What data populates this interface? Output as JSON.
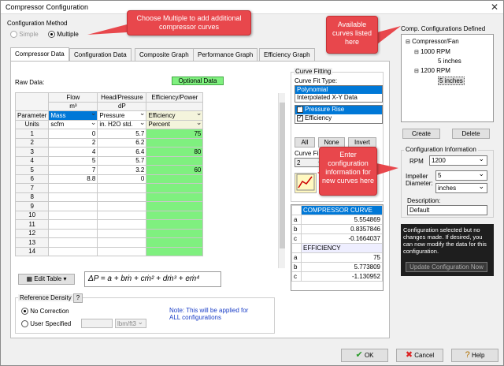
{
  "window": {
    "title": "Compressor Configuration",
    "close_glyph": "✕"
  },
  "method": {
    "label": "Configuration Method",
    "simple": "Simple",
    "multiple": "Multiple"
  },
  "tabs": [
    "Compressor Data",
    "Configuration Data",
    "Composite Graph",
    "Performance Graph",
    "Efficiency Graph"
  ],
  "raw_data_label": "Raw Data:",
  "optional_data": "Optional Data",
  "grid": {
    "col_flow": "Flow",
    "col_flow_unit": "m³",
    "col_head": "Head/Pressure",
    "col_head_unit": "dP",
    "col_eff": "Efficiency/Power",
    "param_label": "Parameter",
    "units_label": "Units",
    "param": {
      "flow": "Mass",
      "head": "Pressure",
      "eff": "Efficiency"
    },
    "units": {
      "flow": "scfm",
      "head": "in. H2O std.",
      "eff": "Percent"
    },
    "rows": [
      {
        "n": "1",
        "flow": "0",
        "head": "5.7",
        "eff": "75"
      },
      {
        "n": "2",
        "flow": "2",
        "head": "6.2",
        "eff": ""
      },
      {
        "n": "3",
        "flow": "4",
        "head": "6.4",
        "eff": "80"
      },
      {
        "n": "4",
        "flow": "5",
        "head": "5.7",
        "eff": ""
      },
      {
        "n": "5",
        "flow": "7",
        "head": "3.2",
        "eff": "60"
      },
      {
        "n": "6",
        "flow": "8.8",
        "head": "0",
        "eff": ""
      },
      {
        "n": "7",
        "flow": "",
        "head": "",
        "eff": ""
      },
      {
        "n": "8",
        "flow": "",
        "head": "",
        "eff": ""
      },
      {
        "n": "9",
        "flow": "",
        "head": "",
        "eff": ""
      },
      {
        "n": "10",
        "flow": "",
        "head": "",
        "eff": ""
      },
      {
        "n": "11",
        "flow": "",
        "head": "",
        "eff": ""
      },
      {
        "n": "12",
        "flow": "",
        "head": "",
        "eff": ""
      },
      {
        "n": "13",
        "flow": "",
        "head": "",
        "eff": ""
      },
      {
        "n": "14",
        "flow": "",
        "head": "",
        "eff": ""
      }
    ]
  },
  "edit_table": "Edit Table",
  "formula": "ΔP = a + bṁ + cṁ² + dṁ³ + eṁ⁴",
  "reference_density": {
    "label": "Reference Density",
    "help": "?",
    "no_correction": "No Correction",
    "user_specified": "User Specified",
    "unit": "lbm/ft3"
  },
  "note": "Note: This will be applied for ALL configurations",
  "curve_fitting": {
    "label": "Curve Fitting",
    "type_label": "Curve Fit Type:",
    "types": [
      "Polynomial",
      "Interpolated X-Y Data"
    ],
    "curves": [
      "Pressure Rise",
      "Efficiency"
    ],
    "all": "All",
    "none": "None",
    "invert": "Invert",
    "order_label": "Curve Fi",
    "order_value": "2"
  },
  "coef": {
    "compressor_header": "COMPRESSOR CURVE",
    "efficiency_header": "EFFICIENCY",
    "compressor": [
      {
        "k": "a",
        "v": "5.554869"
      },
      {
        "k": "b",
        "v": "0.8357846"
      },
      {
        "k": "c",
        "v": "-0.1664037"
      }
    ],
    "efficiency": [
      {
        "k": "a",
        "v": "75"
      },
      {
        "k": "b",
        "v": "5.773809"
      },
      {
        "k": "c",
        "v": "-1.130952"
      }
    ]
  },
  "defined": {
    "label": "Comp. Configurations Defined",
    "root": "Compressor/Fan",
    "n1": "1000 RPM",
    "c1": "5 inches",
    "n2": "1200 RPM",
    "c2": "5 inches"
  },
  "create": "Create",
  "delete": "Delete",
  "info": {
    "label": "Configuration Information",
    "rpm_label": "RPM",
    "rpm": "1200",
    "impeller_label": "Impeller",
    "diameter_label": "Diameter:",
    "impeller": "5",
    "impeller_unit": "inches",
    "desc_label": "Description:",
    "desc": "Default"
  },
  "message": "Configuration selected but no changes made. If desired, you can now modify the data for this configuration.",
  "update_btn": "Update Configuration Now",
  "footer": {
    "ok": "OK",
    "cancel": "Cancel",
    "help": "Help"
  },
  "callouts": {
    "multiple": "Choose Multiple to add additional compressor curves",
    "available": "Available curves listed here",
    "enter": "Enter configuration information for new curves here"
  },
  "colors": {
    "callout": "#e8474c",
    "green": "#7ff07f",
    "select": "#0078d7"
  }
}
